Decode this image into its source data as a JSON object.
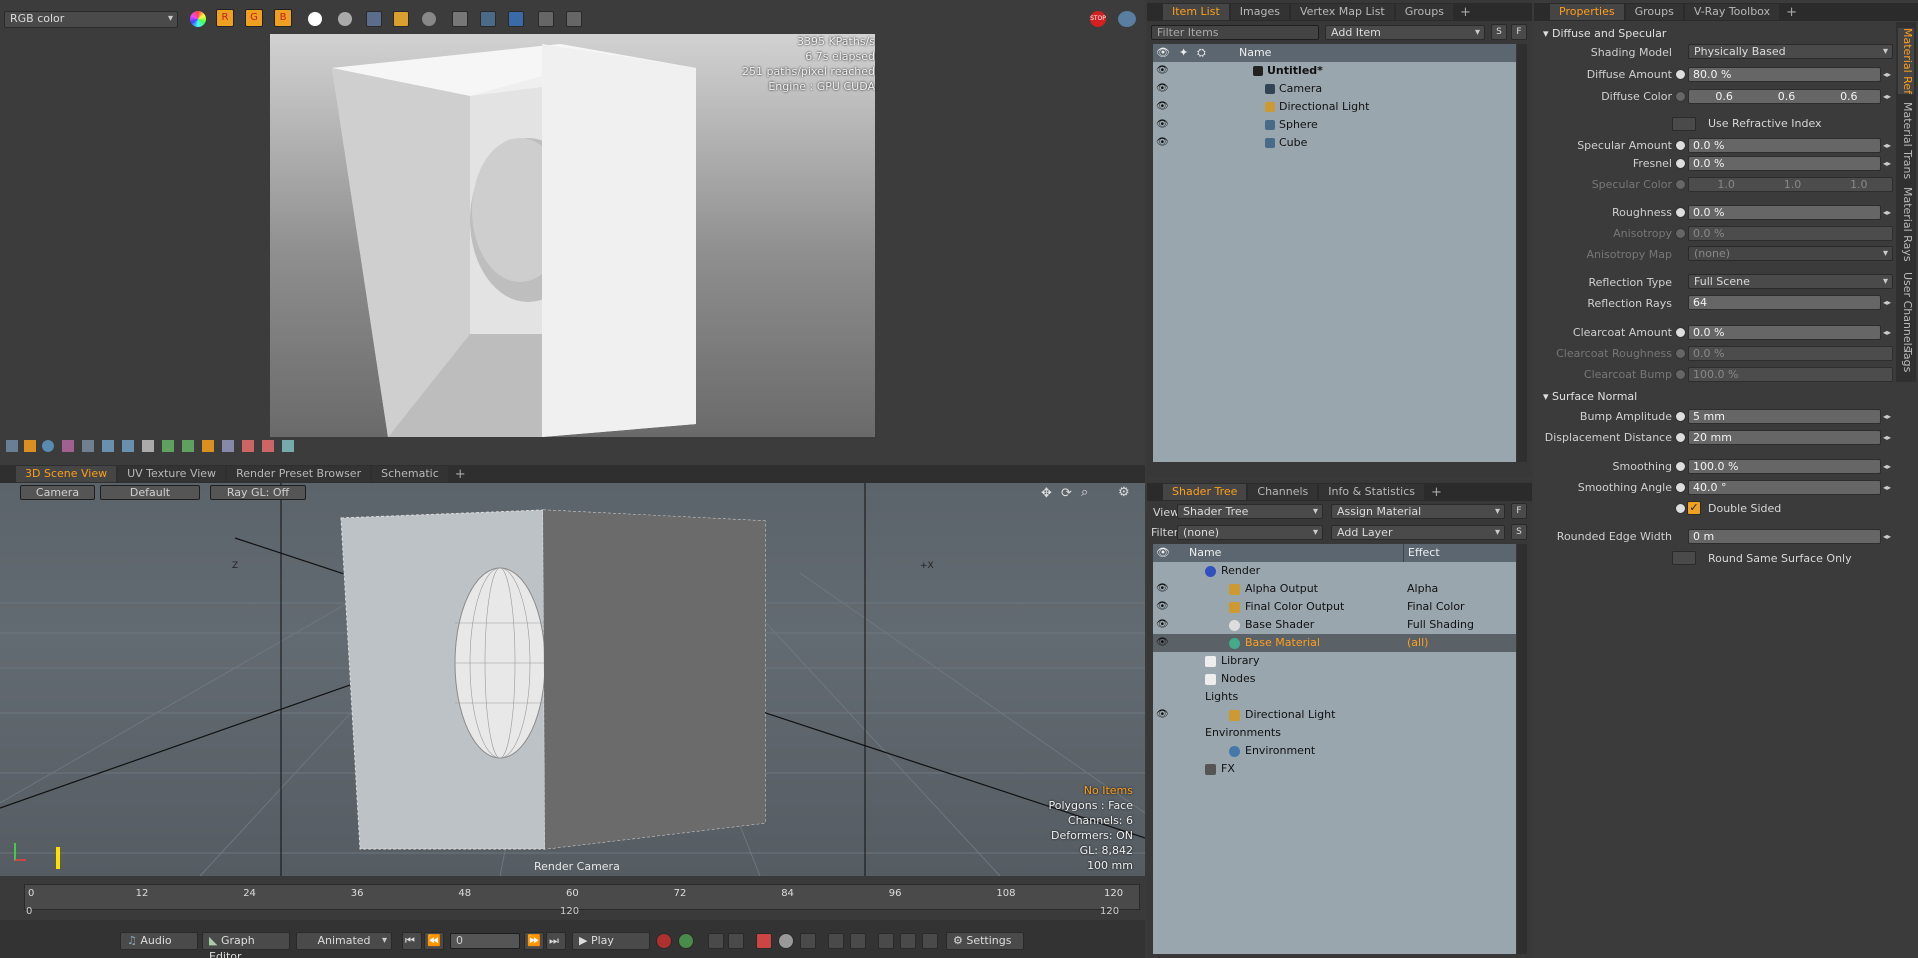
{
  "render_view": {
    "color_mode": "RGB color",
    "stats": [
      "3395 KPaths/s",
      "6.7s elapsed",
      "251 paths/pixel reached",
      "Engine : GPU CUDA"
    ]
  },
  "viewport": {
    "tabs": [
      "3D Scene View",
      "UV Texture View",
      "Render Preset Browser",
      "Schematic"
    ],
    "active_tab": 0,
    "controls": [
      "Camera",
      "Default",
      "Ray GL: Off"
    ],
    "info": [
      "No Items",
      "Polygons : Face",
      "Channels: 6",
      "Deformers: ON",
      "GL: 8,842",
      "100 mm"
    ],
    "camera_label": "Render Camera",
    "axis_x": "+X",
    "axis_z": "Z"
  },
  "timeline": {
    "ticks": [
      "0",
      "12",
      "24",
      "36",
      "48",
      "60",
      "72",
      "84",
      "96",
      "108",
      "120",
      "120"
    ],
    "range_start": "0",
    "range_mid": "120",
    "range_end": "120"
  },
  "bottom_bar": {
    "audio": "Audio",
    "graph_editor": "Graph Editor",
    "animated": "Animated",
    "frame": "0",
    "play": "Play",
    "settings": "Settings"
  },
  "item_list": {
    "tabs": [
      "Item List",
      "Images",
      "Vertex Map List",
      "Groups"
    ],
    "filter_placeholder": "Filter Items",
    "add_item": "Add Item",
    "btn_s": "S",
    "btn_f": "F",
    "col_name": "Name",
    "items": [
      {
        "name": "Untitled*",
        "type": "scene",
        "bold": true
      },
      {
        "name": "Camera",
        "type": "camera"
      },
      {
        "name": "Directional Light",
        "type": "light"
      },
      {
        "name": "Sphere",
        "type": "mesh"
      },
      {
        "name": "Cube",
        "type": "mesh"
      }
    ]
  },
  "shader_tree": {
    "tabs": [
      "Shader Tree",
      "Channels",
      "Info & Statistics"
    ],
    "view_label": "View",
    "view_value": "Shader Tree",
    "assign_material": "Assign Material",
    "filter_label": "Filter",
    "filter_value": "(none)",
    "add_layer": "Add Layer",
    "btn_f": "F",
    "btn_s": "S",
    "col_name": "Name",
    "col_effect": "Effect",
    "rows": [
      {
        "name": "Render",
        "effect": "",
        "indent": 0,
        "icon": "render",
        "eye": false
      },
      {
        "name": "Alpha Output",
        "effect": "Alpha",
        "indent": 1,
        "icon": "output",
        "eye": true
      },
      {
        "name": "Final Color Output",
        "effect": "Final Color",
        "indent": 1,
        "icon": "output",
        "eye": true
      },
      {
        "name": "Base Shader",
        "effect": "Full Shading",
        "indent": 1,
        "icon": "shader",
        "eye": true
      },
      {
        "name": "Base Material",
        "effect": "(all)",
        "indent": 1,
        "icon": "material",
        "eye": true,
        "selected": true
      },
      {
        "name": "Library",
        "effect": "",
        "indent": 0,
        "icon": "folder",
        "eye": false
      },
      {
        "name": "Nodes",
        "effect": "",
        "indent": 0,
        "icon": "folder",
        "eye": false
      },
      {
        "name": "Lights",
        "effect": "",
        "indent": 0,
        "icon": "none",
        "eye": false
      },
      {
        "name": "Directional Light",
        "effect": "",
        "indent": 1,
        "icon": "light",
        "eye": true
      },
      {
        "name": "Environments",
        "effect": "",
        "indent": 0,
        "icon": "none",
        "eye": false
      },
      {
        "name": "Environment",
        "effect": "",
        "indent": 1,
        "icon": "env",
        "eye": false
      },
      {
        "name": "FX",
        "effect": "",
        "indent": 0,
        "icon": "fx",
        "eye": false
      }
    ]
  },
  "properties": {
    "tabs": [
      "Properties",
      "Groups",
      "V-Ray Toolbox"
    ],
    "side_tabs": [
      "Material Ref",
      "Material Trans",
      "Material Rays",
      "User Channels",
      "Tags"
    ],
    "section_diffuse": "Diffuse and Specular",
    "section_normal": "Surface Normal",
    "shading_model_label": "Shading Model",
    "shading_model": "Physically Based",
    "diffuse_amount_label": "Diffuse Amount",
    "diffuse_amount": "80.0 %",
    "diffuse_color_label": "Diffuse Color",
    "diffuse_color": [
      "0.6",
      "0.6",
      "0.6"
    ],
    "use_refractive": "Use Refractive Index",
    "specular_amount_label": "Specular Amount",
    "specular_amount": "0.0 %",
    "fresnel_label": "Fresnel",
    "fresnel": "0.0 %",
    "specular_color_label": "Specular Color",
    "specular_color": [
      "1.0",
      "1.0",
      "1.0"
    ],
    "roughness_label": "Roughness",
    "roughness": "0.0 %",
    "anisotropy_label": "Anisotropy",
    "anisotropy": "0.0 %",
    "anisotropy_map_label": "Anisotropy Map",
    "anisotropy_map": "(none)",
    "reflection_type_label": "Reflection Type",
    "reflection_type": "Full Scene",
    "reflection_rays_label": "Reflection Rays",
    "reflection_rays": "64",
    "clearcoat_amount_label": "Clearcoat Amount",
    "clearcoat_amount": "0.0 %",
    "clearcoat_roughness_label": "Clearcoat Roughness",
    "clearcoat_roughness": "0.0 %",
    "clearcoat_bump_label": "Clearcoat Bump",
    "clearcoat_bump": "100.0 %",
    "bump_amplitude_label": "Bump Amplitude",
    "bump_amplitude": "5 mm",
    "displacement_label": "Displacement Distance",
    "displacement": "20 mm",
    "smoothing_label": "Smoothing",
    "smoothing": "100.0 %",
    "smoothing_angle_label": "Smoothing Angle",
    "smoothing_angle": "40.0 °",
    "double_sided": "Double Sided",
    "rounded_edge_label": "Rounded Edge Width",
    "rounded_edge": "0 m",
    "round_same": "Round Same Surface Only"
  },
  "colors": {
    "accent": "#ff9f1c",
    "panel": "#383838",
    "tree_bg": "#9aa6ae",
    "selected_row": "#5a6167"
  }
}
